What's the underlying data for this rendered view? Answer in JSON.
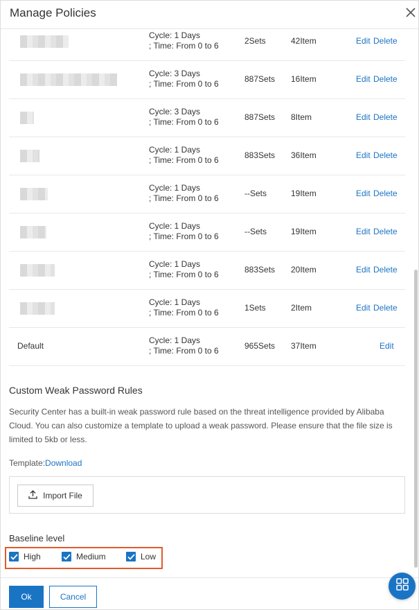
{
  "dialog": {
    "title": "Manage Policies"
  },
  "policies": [
    {
      "cycle": "Cycle: 1 Days",
      "time": "; Time: From 0 to 6",
      "sets": "2Sets",
      "items": "42Item",
      "edit": "Edit",
      "delete": "Delete"
    },
    {
      "cycle": "Cycle: 3 Days",
      "time": "; Time: From 0 to 6",
      "sets": "887Sets",
      "items": "16Item",
      "edit": "Edit",
      "delete": "Delete"
    },
    {
      "cycle": "Cycle: 3 Days",
      "time": "; Time: From 0 to 6",
      "sets": "887Sets",
      "items": "8Item",
      "edit": "Edit",
      "delete": "Delete"
    },
    {
      "cycle": "Cycle: 1 Days",
      "time": "; Time: From 0 to 6",
      "sets": "883Sets",
      "items": "36Item",
      "edit": "Edit",
      "delete": "Delete"
    },
    {
      "cycle": "Cycle: 1 Days",
      "time": "; Time: From 0 to 6",
      "sets": "--Sets",
      "items": "19Item",
      "edit": "Edit",
      "delete": "Delete"
    },
    {
      "cycle": "Cycle: 1 Days",
      "time": "; Time: From 0 to 6",
      "sets": "--Sets",
      "items": "19Item",
      "edit": "Edit",
      "delete": "Delete"
    },
    {
      "cycle": "Cycle: 1 Days",
      "time": "; Time: From 0 to 6",
      "sets": "883Sets",
      "items": "20Item",
      "edit": "Edit",
      "delete": "Delete"
    },
    {
      "cycle": "Cycle: 1 Days",
      "time": "; Time: From 0 to 6",
      "sets": "1Sets",
      "items": "2Item",
      "edit": "Edit",
      "delete": "Delete"
    },
    {
      "name": "Default",
      "cycle": "Cycle: 1 Days",
      "time": "; Time: From 0 to 6",
      "sets": "965Sets",
      "items": "37Item",
      "edit": "Edit"
    }
  ],
  "weak_password": {
    "title": "Custom Weak Password Rules",
    "description": "Security Center has a built-in weak password rule based on the threat intelligence provided by Alibaba Cloud. You can also customize a template to upload a weak password. Please ensure that the file size is limited to 5kb or less.",
    "template_label": "Template:",
    "download_label": "Download",
    "import_label": "Import File"
  },
  "baseline": {
    "title": "Baseline level",
    "options": [
      {
        "label": "High",
        "checked": true
      },
      {
        "label": "Medium",
        "checked": true
      },
      {
        "label": "Low",
        "checked": true
      }
    ]
  },
  "footer": {
    "ok_label": "Ok",
    "cancel_label": "Cancel"
  },
  "colors": {
    "accent": "#1a74c4",
    "highlight": "#e05a2b"
  }
}
